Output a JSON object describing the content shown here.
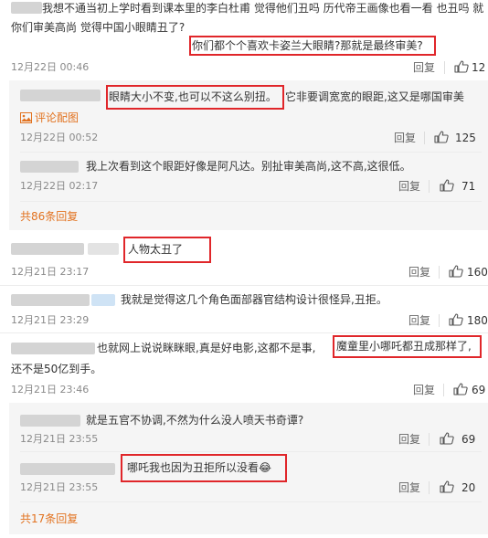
{
  "comments": [
    {
      "line1": "我想不通当初上学时看到课本里的李白杜甫 觉得他们丑吗 历代帝王画像也看一看 也丑吗 就",
      "line2_plain": "你们审美高尚 觉得中国小眼睛丑了?",
      "line2_boxed": "你们都个个喜欢卡姿兰大眼睛?那就是最终审美?",
      "time": "12月22日 00:46",
      "reply": "回复",
      "likes": "12"
    },
    {
      "boxed": "眼睛大小不变,也可以不这么别扭。",
      "rest": "它非要调宽宽的眼距,这又是哪国审美",
      "link": "评论配图",
      "time": "12月22日 00:52",
      "reply": "回复",
      "likes": "125"
    },
    {
      "text": "我上次看到这个眼距好像是阿凡达。别扯审美高尚,这不高,这很低。",
      "time": "12月22日 02:17",
      "reply": "回复",
      "likes": "71"
    },
    {
      "more": "共86条回复"
    },
    {
      "boxed": "人物太丑了",
      "time": "12月21日 23:17",
      "reply": "回复",
      "likes": "160"
    },
    {
      "text": "我就是觉得这几个角色面部器官结构设计很怪异,丑拒。",
      "time": "12月21日 23:29",
      "reply": "回复",
      "likes": "180"
    },
    {
      "line1_plain": "也就网上说说眯眯眼,真是好电影,这都不是事,",
      "line1_boxed": "魔童里小哪吒都丑成那样了,",
      "line2": "还不是50亿到手。",
      "time": "12月21日 23:46",
      "reply": "回复",
      "likes": "69"
    },
    {
      "text": "就是五官不协调,不然为什么没人喷天书奇谭?",
      "time": "12月21日 23:55",
      "reply": "回复",
      "likes": "69"
    },
    {
      "boxed": "哪吒我也因为丑拒所以没看😂",
      "time": "12月21日 23:55",
      "reply": "回复",
      "likes": "20"
    },
    {
      "more": "共17条回复"
    }
  ],
  "icons": {
    "like": "thumbs-up-icon",
    "image": "image-icon",
    "badge": "vip-badge-icon"
  },
  "colors": {
    "link": "#e2721f",
    "highlight_box": "#e0262a",
    "subpanel": "#f5f5f5"
  }
}
